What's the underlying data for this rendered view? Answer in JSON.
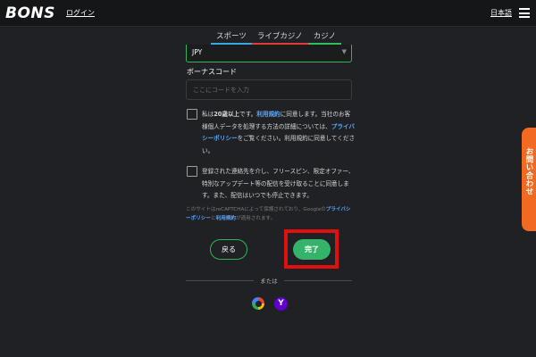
{
  "header": {
    "logo": "BONS",
    "login_label": "ログイン",
    "language_label": "日本語"
  },
  "tabs": [
    {
      "label": "スポーツ"
    },
    {
      "label": "ライブカジノ"
    },
    {
      "label": "カジノ"
    }
  ],
  "form": {
    "currency_value": "JPY",
    "bonus_label": "ボーナスコード",
    "bonus_placeholder": "ここにコードを入力",
    "terms_prefix": "私は",
    "terms_age": "20歳以上",
    "terms_mid1": "です。",
    "terms_link": "利用規約",
    "terms_mid2": "に同意します。当社のお客様個人データを処理する方法の詳細については、",
    "privacy_link": "プライバシーポリシー",
    "terms_suffix": "をご覧ください。利用規約に同意してください。",
    "marketing_text": "登録された連絡先を介し、フリースピン、限定オファー、特別なアップデート等の配信を受け取ることに同意します。また、配信はいつでも停止できます。",
    "captcha_prefix": "このサイトはreCAPTCHAによって保護されており、Googleの",
    "captcha_privacy_link": "プライバシーポリシー",
    "captcha_and": "と",
    "captcha_terms_link": "利用規約",
    "captcha_suffix": "が適用されます。",
    "back_label": "戻る",
    "done_label": "完了",
    "or_label": "または"
  },
  "social": {
    "yahoo_glyph": "Y"
  },
  "contact_tab": {
    "label": "お問い合わせ"
  },
  "colors": {
    "accent_green": "#2fb552",
    "link_blue": "#58a9ff",
    "highlight_red": "#e01010",
    "contact_orange": "#f26a21"
  }
}
